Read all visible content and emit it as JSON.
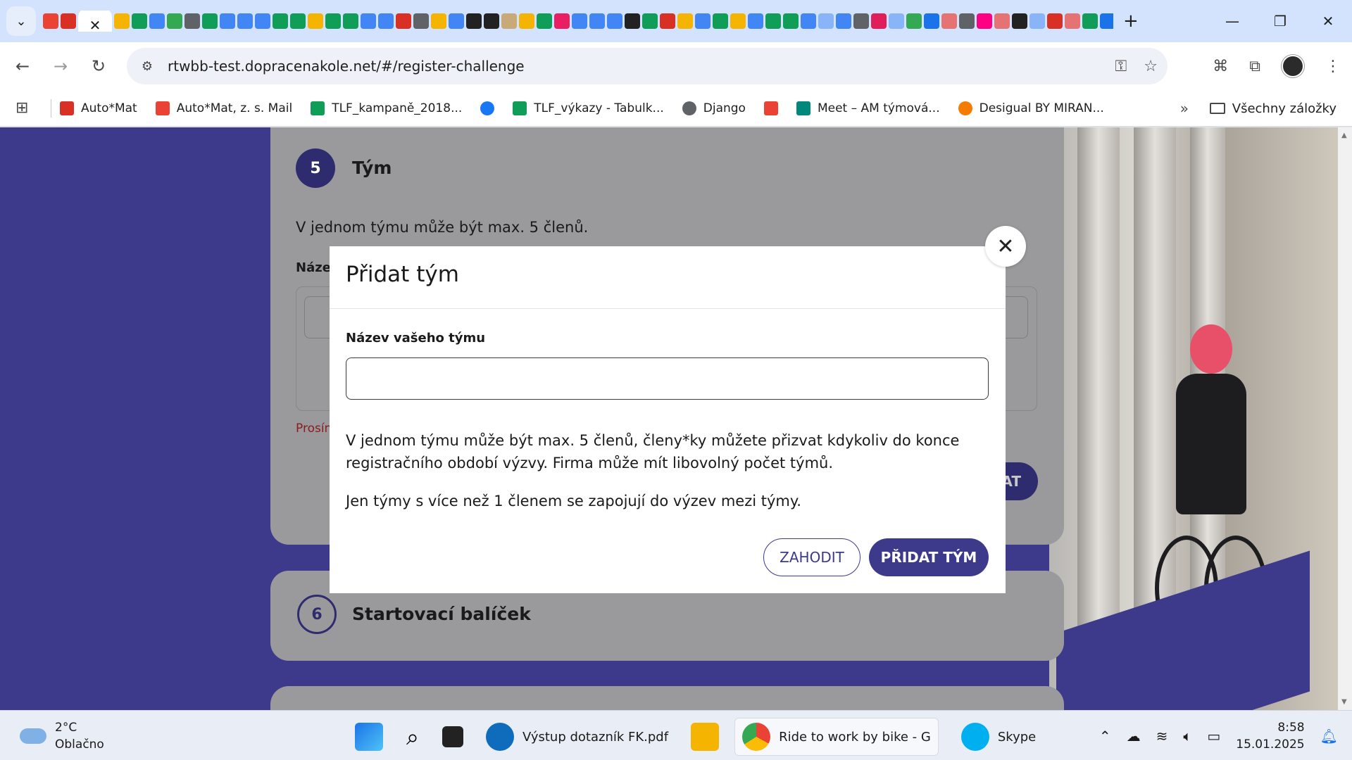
{
  "browser": {
    "url": "rtwbb-test.dopracenakole.net/#/register-challenge",
    "bookmarks": [
      {
        "label": "Auto*Mat",
        "color": "#d93025"
      },
      {
        "label": "Auto*Mat, z. s. Mail",
        "color": "#ea4335"
      },
      {
        "label": "TLF_kampaně_2018...",
        "color": "#0f9d58"
      },
      {
        "label": "",
        "color": "#1877f2"
      },
      {
        "label": "TLF_výkazy - Tabulk...",
        "color": "#0f9d58"
      },
      {
        "label": "Django",
        "color": "#5f6368"
      },
      {
        "label": "",
        "color": "#ea4335"
      },
      {
        "label": "Meet – AM týmová...",
        "color": "#00897b"
      },
      {
        "label": "Desigual BY MIRAN...",
        "color": "#f57c00"
      }
    ],
    "bookmarks_folder": "Všechny záložky"
  },
  "page": {
    "card5": {
      "step": "5",
      "title": "Tým",
      "text": "V jednom týmu může být max. 5 členů.",
      "label_partial": "Náze",
      "error_partial": "Prosín",
      "button_partial": "AT"
    },
    "card6": {
      "step": "6",
      "title": "Startovací balíček"
    }
  },
  "modal": {
    "title": "Přidat tým",
    "field_label": "Název vašeho týmu",
    "field_value": "",
    "paragraph1": "V jednom týmu může být max. 5 členů, členy*ky můžete přizvat kdykoliv do konce registračního období výzvy. Firma může mít libovolný počet týmů.",
    "paragraph2": "Jen týmy s více než 1 členem se zapojují do výzev mezi týmy.",
    "discard_label": "ZAHODIT",
    "add_label": "PŘIDAT TÝM"
  },
  "taskbar": {
    "weather_temp": "2°C",
    "weather_desc": "Oblačno",
    "apps": [
      {
        "label": "Výstup dotazník FK.pdf",
        "color": "#0f6cbd"
      },
      {
        "label": "Ride to work by bike - G",
        "color": "#34a853"
      },
      {
        "label": "Skype",
        "color": "#00aff0"
      }
    ],
    "time": "8:58",
    "date": "15.01.2025"
  },
  "colors": {
    "brand_purple": "#3d3a8c",
    "page_background": "#3d3a8c"
  }
}
